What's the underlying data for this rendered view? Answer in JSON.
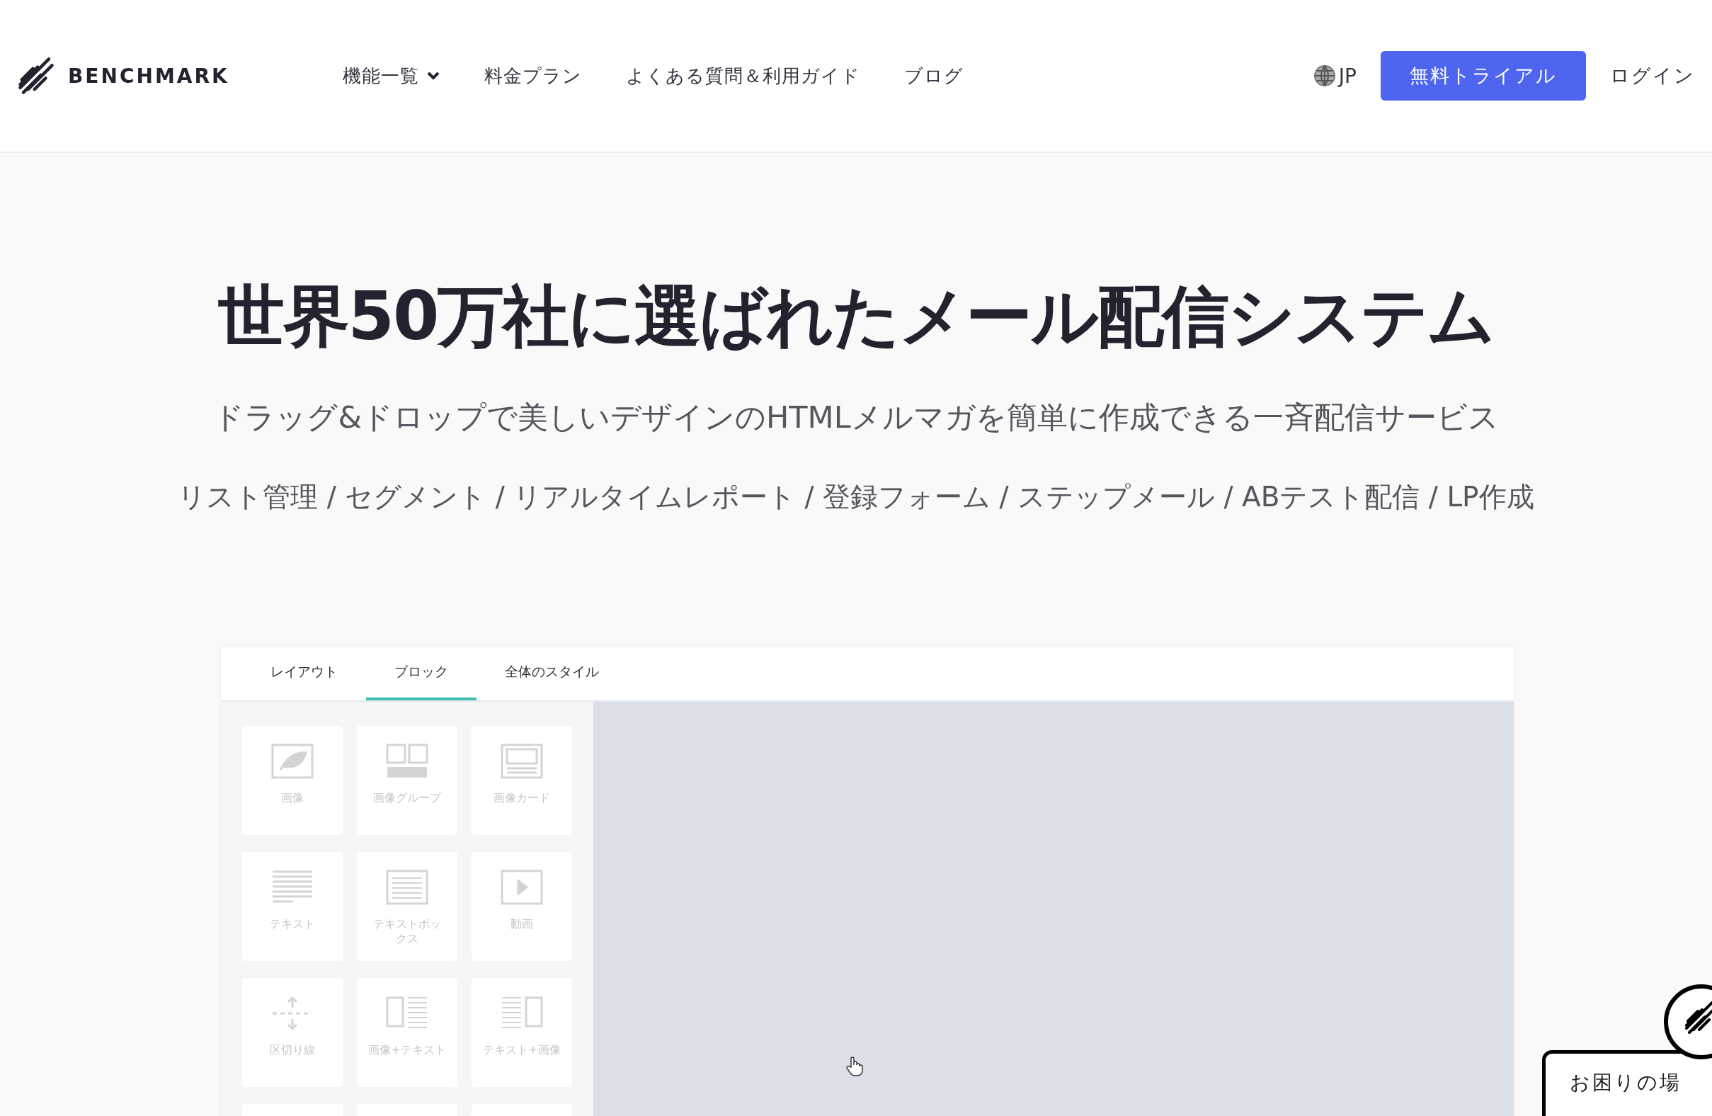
{
  "header": {
    "logo": "BENCHMARK",
    "nav": [
      {
        "label": "機能一覧",
        "dropdown": true
      },
      {
        "label": "料金プラン",
        "dropdown": false
      },
      {
        "label": "よくある質問＆利用ガイド",
        "dropdown": false
      },
      {
        "label": "ブログ",
        "dropdown": false
      }
    ],
    "language": "JP",
    "trial_button": "無料トライアル",
    "login": "ログイン"
  },
  "hero": {
    "title": "世界50万社に選ばれたメール配信システム",
    "subtitle": "ドラッグ&ドロップで美しいデザインのHTMLメルマガを簡単に作成できる一斉配信サービス",
    "features": "リスト管理 / セグメント / リアルタイムレポート / 登録フォーム / ステップメール / ABテスト配信 / LP作成"
  },
  "editor": {
    "tabs": [
      {
        "label": "レイアウト",
        "selected": false
      },
      {
        "label": "ブロック",
        "selected": true
      },
      {
        "label": "全体のスタイル",
        "selected": false
      }
    ],
    "blocks": [
      {
        "label": "画像",
        "kind": "image"
      },
      {
        "label": "画像グループ",
        "kind": "group"
      },
      {
        "label": "画像カード",
        "kind": "card"
      },
      {
        "label": "テキスト",
        "kind": "text"
      },
      {
        "label": "テキストボックス",
        "kind": "textbox"
      },
      {
        "label": "動画",
        "kind": "video"
      },
      {
        "label": "区切り線",
        "kind": "divider"
      },
      {
        "label": "画像+テキスト",
        "kind": "imagetext"
      },
      {
        "label": "テキスト+画像",
        "kind": "textimage"
      }
    ]
  },
  "help": {
    "label": "お困りの場"
  }
}
